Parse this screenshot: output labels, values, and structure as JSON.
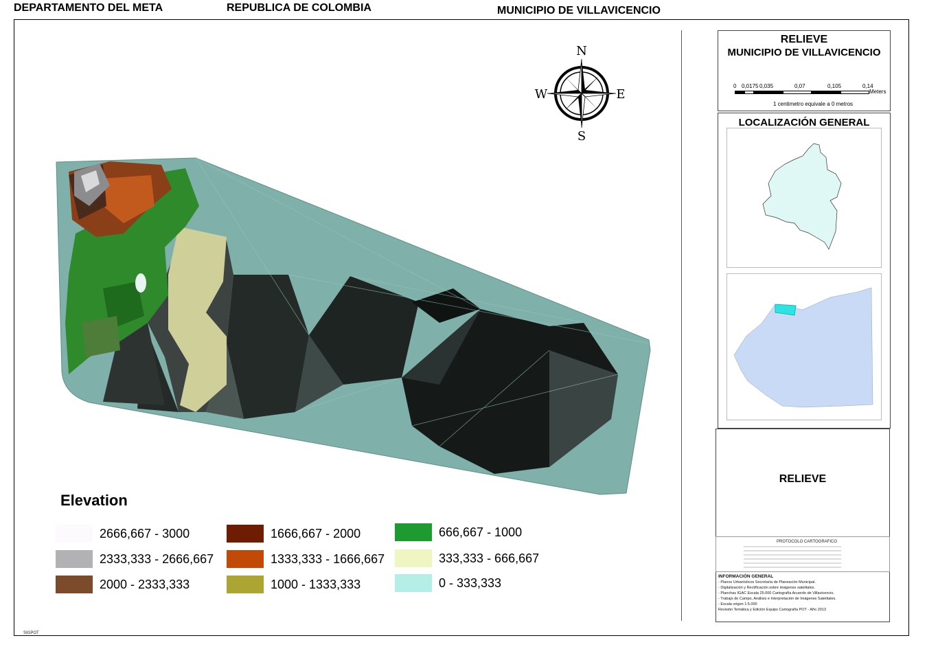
{
  "header": {
    "left": "DEPARTAMENTO DEL META",
    "center": "REPUBLICA DE COLOMBIA",
    "right": "MUNICIPIO DE VILLAVICENCIO"
  },
  "compass": {
    "n": "N",
    "s": "S",
    "e": "E",
    "w": "W"
  },
  "legend": {
    "title": "Elevation",
    "items": [
      {
        "label": "2666,667 - 3000",
        "color": "#fcfafc"
      },
      {
        "label": "2333,333 - 2666,667",
        "color": "#b2b1b4"
      },
      {
        "label": "2000 - 2333,333",
        "color": "#7b4b2b"
      },
      {
        "label": "1666,667 - 2000",
        "color": "#6e1c03"
      },
      {
        "label": "1333,333 - 1666,667",
        "color": "#c04a06"
      },
      {
        "label": "1000 - 1333,333",
        "color": "#aca534"
      },
      {
        "label": "666,667 - 1000",
        "color": "#1e9b30"
      },
      {
        "label": "333,333 - 666,667",
        "color": "#eff6c1"
      },
      {
        "label": "0 - 333,333",
        "color": "#b4eee6"
      }
    ]
  },
  "title_panel": {
    "line1": "RELIEVE",
    "line2": "MUNICIPIO DE VILLAVICENCIO",
    "scale_labels": [
      "0",
      "0,0175",
      "0,035",
      "0,07",
      "0,105",
      "0,14"
    ],
    "scale_units": "Meters",
    "scale_note": "1 centimetro equivale a 0 metros"
  },
  "location_panel": {
    "title": "LOCALIZACIÓN GENERAL"
  },
  "theme_panel": {
    "title": "RELIEVE"
  },
  "info_panel": {
    "table_heading": "PROTOCOLO CARTOGRAFICO",
    "heading": "INFORMACIÓN GENERAL",
    "lines": [
      "- Planos Urbanísticos Secretaría de Planeación Municipal.",
      "- Digitalización y Rectificación sobre imágenes satelitales.",
      "- Planchas IGAC Escala 25.000 Cartografía Acuerdo de Villavicencio.",
      "- Trabajo de Campo, Análisis e Interpretación de Imágenes Satelitales.",
      "- Escala origen 1:5.000",
      "Revisión Temática y Edición Equipo Cartografía POT - Año 2013"
    ]
  },
  "footer_mark": "SIGPOT"
}
